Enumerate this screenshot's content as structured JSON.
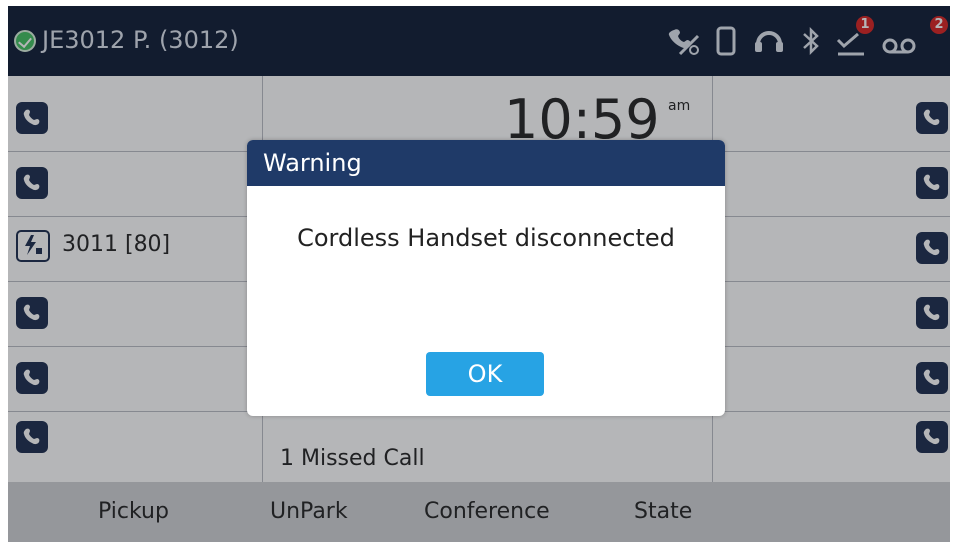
{
  "topbar": {
    "account_title": "JE3012 P. (3012)",
    "status_color": "#3fbf5f",
    "icons": [
      "call-forward-icon",
      "handset-icon",
      "headset-icon",
      "bluetooth-icon",
      "missed-call-icon",
      "voicemail-icon"
    ],
    "missed_badge": "1",
    "voicemail_badge": "2",
    "badge_color": "#d8201f"
  },
  "main": {
    "clock": "10:59",
    "ampm": "am",
    "blf_label": "3011 [80]",
    "missed_calls": "1 Missed Call"
  },
  "softkeys": [
    "Pickup",
    "UnPark",
    "Conference",
    "State"
  ],
  "dialog": {
    "title": "Warning",
    "message": "Cordless Handset disconnected",
    "ok_label": "OK",
    "header_color": "#1f3a68",
    "button_color": "#27a3e4"
  }
}
